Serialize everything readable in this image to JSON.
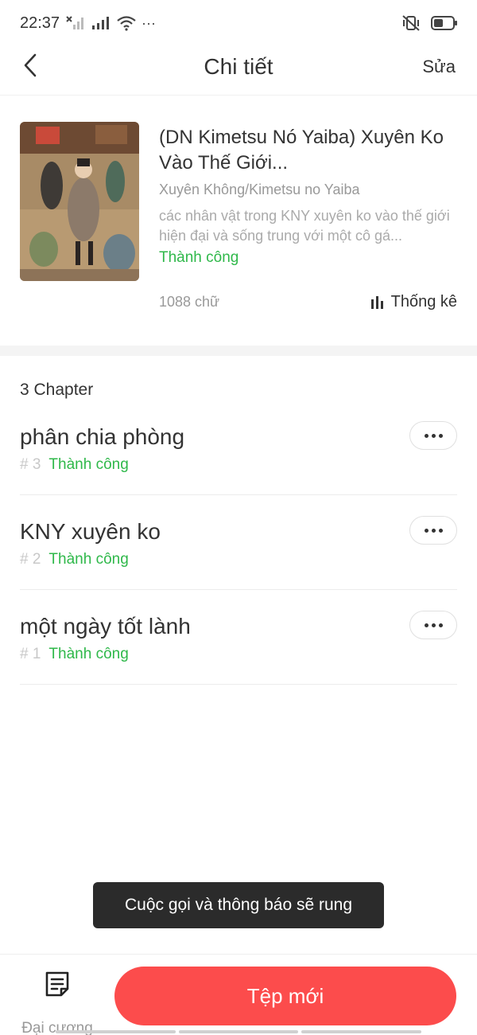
{
  "status_bar": {
    "time": "22:37",
    "more": "···",
    "icons": [
      "signal-off-icon",
      "signal-icon",
      "wifi-icon",
      "vibrate-icon",
      "battery-icon"
    ]
  },
  "header": {
    "title": "Chi tiết",
    "edit_label": "Sửa"
  },
  "book": {
    "title": "(DN Kimetsu Nó Yaiba) Xuyên Ko Vào Thế Giới...",
    "tags": "Xuyên Không/Kimetsu no Yaiba",
    "description": "các nhân vật trong KNY xuyên ko vào thế giới hiện đại và sống trung với một cô gá...",
    "status": "Thành công",
    "word_count": "1088 chữ",
    "stats_label": "Thống kê"
  },
  "chapters": {
    "count_label": "3 Chapter",
    "items": [
      {
        "title": "phân chia phòng",
        "number": "# 3",
        "status": "Thành công"
      },
      {
        "title": "KNY xuyên ko",
        "number": "# 2",
        "status": "Thành công"
      },
      {
        "title": "một ngày tốt lành",
        "number": "# 1",
        "status": "Thành công"
      }
    ]
  },
  "toast": {
    "text": "Cuộc gọi và thông báo sẽ rung"
  },
  "bottom_bar": {
    "outline_label": "Đại cương",
    "new_file_label": "Tệp mới"
  },
  "colors": {
    "accent": "#fc4c4c",
    "success": "#2fb84a"
  }
}
